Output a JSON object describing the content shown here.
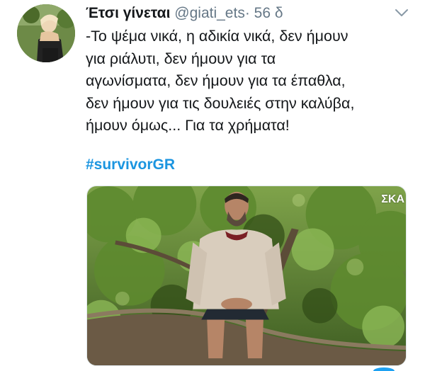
{
  "tweet": {
    "display_name": "Έτσι γίνεται",
    "handle": "@giati_ets",
    "separator": "·",
    "time": "56 δ",
    "text": "-Το ψέμα νικά, η αδικία νικά, δεν ήμουν\nγια ριάλυτι, δεν ήμουν για τα\nαγωνίσματα, δεν ήμουν για τα έπαθλα,\nδεν ήμουν για τις δουλειές στην καλύβα,\nήμουν όμως... Για τα χρήματα!",
    "hashtag": "#survivorGR",
    "media": {
      "channel_logo": "ΣΚΑ",
      "description_icon": "photo"
    }
  },
  "icons": {
    "menu": "chevron-down-icon"
  },
  "colors": {
    "link": "#1b95e0",
    "secondary_text": "#657786",
    "primary_text": "#14171a",
    "border": "#e1e8ed"
  }
}
